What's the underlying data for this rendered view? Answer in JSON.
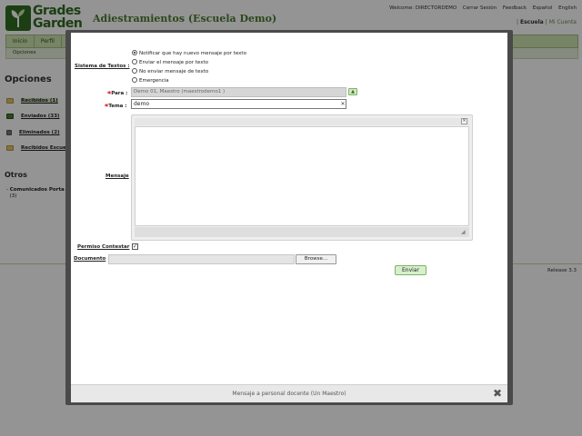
{
  "app": {
    "logo_text_1": "Grades",
    "logo_text_2": "Garden",
    "title": "Adiestramientos (Escuela Demo)"
  },
  "top_links": {
    "welcome": "Welcome: DIRECTORDEMO",
    "logout": "Cerrar Sesión",
    "feedback": "Feedback",
    "lang_es": "Español",
    "lang_en": "English"
  },
  "school_links": {
    "escuela": "Escuela",
    "cuenta": "Mi Cuenta"
  },
  "nav": {
    "tabs": [
      "Inicio",
      "Perfil"
    ],
    "sub_tabs": [
      "Opciones"
    ]
  },
  "sidebar": {
    "title": "Opciones",
    "items": [
      {
        "label": "Recibidos (1)",
        "icon": "folder-icon"
      },
      {
        "label": "Enviados (33)",
        "icon": "sent-icon"
      },
      {
        "label": "Eliminados (2)",
        "icon": "trash-icon"
      },
      {
        "label": "Recibidos Escue",
        "icon": "folder-icon"
      }
    ],
    "otros_title": "Otros",
    "otros_item_line1": "Comunicados Porta",
    "otros_item_line2": "(3)"
  },
  "release": "Release 3.3",
  "modal": {
    "sistema_label": "Sistema de Textos :",
    "radio_options": [
      "Notificar que hay nuevo mensaje por texto",
      "Enviar el mensaje por texto",
      "No enviar mensaje de texto",
      "Emergencia"
    ],
    "radio_selected": 0,
    "para_label": "Para :",
    "para_value": "Demo 01, Maestro (maestrodemo1 )",
    "tema_label": "Tema :",
    "tema_value": "demo",
    "mensaje_label": "Mensaje",
    "permiso_label": "Permiso Contestar",
    "permiso_checked": true,
    "documento_label": "Documento",
    "browse_label": "Browse...",
    "send_label": "Enviar",
    "footer_caption": "Mensaje a personal docente (Un Maestro)",
    "close_glyph": "✖",
    "clear_glyph": "✕",
    "expand_glyph": "▲",
    "editor_tb_glyph": "×",
    "grip_glyph": "◢",
    "check_glyph": "✓"
  },
  "colors": {
    "brand_green": "#2f6b1f",
    "nav_green": "#cfe3b0",
    "required_red": "#dd0000",
    "modal_frame": "#4a4a4a"
  }
}
